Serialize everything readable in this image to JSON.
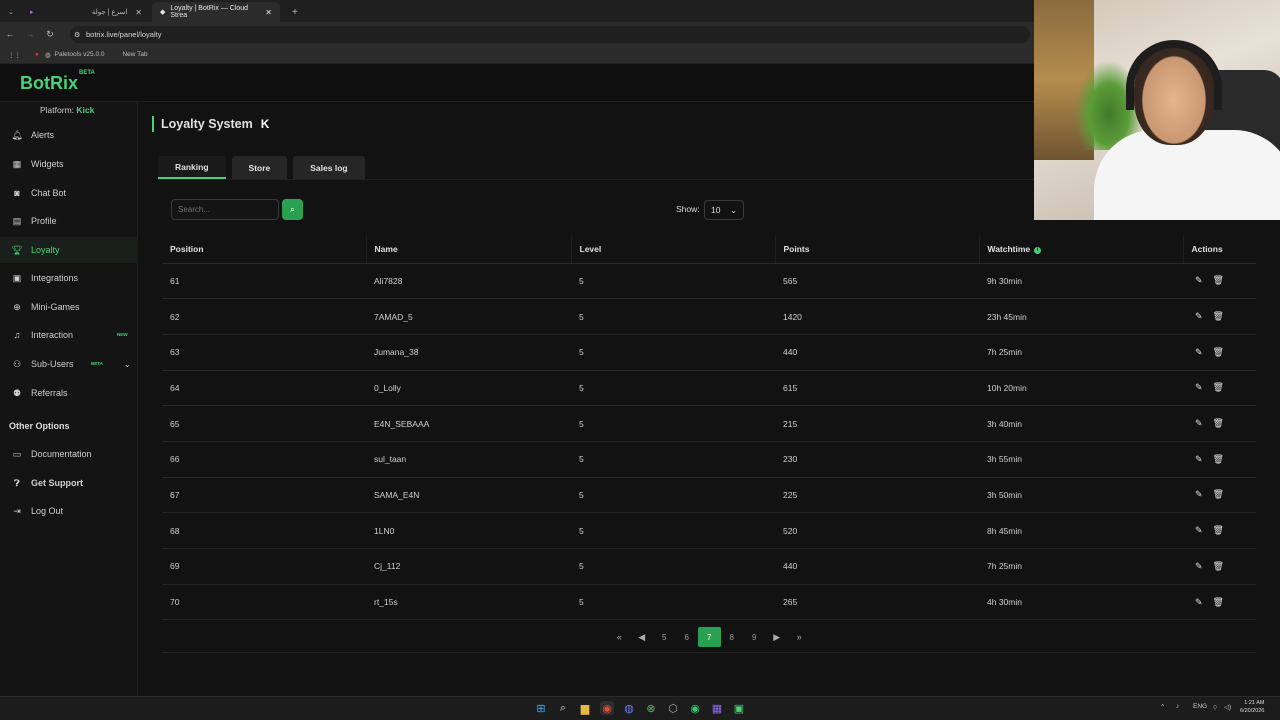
{
  "browser": {
    "tabs": [
      {
        "title": "اسرع | جولة",
        "active": false
      },
      {
        "title": "Loyalty | BotRix — Cloud Strea",
        "active": true
      }
    ],
    "url": "botrix.live/panel/loyalty",
    "bookmarks": [
      "Paletools v25.0.0",
      "New Tab"
    ]
  },
  "app": {
    "logo": "BotRix",
    "logo_badge": "BETA",
    "platform_label": "Platform:",
    "platform_value": "Kick"
  },
  "sidebar": {
    "items": [
      {
        "label": "Alerts",
        "icon": "bell-icon"
      },
      {
        "label": "Widgets",
        "icon": "grid-icon"
      },
      {
        "label": "Chat Bot",
        "icon": "robot-icon"
      },
      {
        "label": "Profile",
        "icon": "id-card-icon"
      },
      {
        "label": "Loyalty",
        "icon": "trophy-icon",
        "active": true
      },
      {
        "label": "Integrations",
        "icon": "plug-icon"
      },
      {
        "label": "Mini-Games",
        "icon": "gamepad-icon"
      },
      {
        "label": "Interaction",
        "icon": "music-icon",
        "badge": "NEW"
      },
      {
        "label": "Sub-Users",
        "icon": "users-icon",
        "badge": "BETA"
      },
      {
        "label": "Referrals",
        "icon": "user-group-icon"
      }
    ],
    "other_heading": "Other Options",
    "other_items": [
      {
        "label": "Documentation",
        "icon": "book-icon"
      },
      {
        "label": "Get Support",
        "icon": "question-icon"
      },
      {
        "label": "Log Out",
        "icon": "logout-icon"
      }
    ]
  },
  "main": {
    "title": "Loyalty System",
    "tabs": [
      "Ranking",
      "Store",
      "Sales log"
    ],
    "search_placeholder": "Search...",
    "show_label": "Show:",
    "show_value": "10",
    "columns": [
      "Position",
      "Name",
      "Level",
      "Points",
      "Watchtime",
      "Actions"
    ],
    "rows": [
      {
        "position": "61",
        "name": "Ali7828",
        "level": "5",
        "points": "565",
        "watchtime": "9h 30min"
      },
      {
        "position": "62",
        "name": "7AMAD_5",
        "level": "5",
        "points": "1420",
        "watchtime": "23h 45min"
      },
      {
        "position": "63",
        "name": "Jumana_38",
        "level": "5",
        "points": "440",
        "watchtime": "7h 25min"
      },
      {
        "position": "64",
        "name": "0_Lolly",
        "level": "5",
        "points": "615",
        "watchtime": "10h 20min"
      },
      {
        "position": "65",
        "name": "E4N_SEBAAA",
        "level": "5",
        "points": "215",
        "watchtime": "3h 40min"
      },
      {
        "position": "66",
        "name": "sul_taan",
        "level": "5",
        "points": "230",
        "watchtime": "3h 55min"
      },
      {
        "position": "67",
        "name": "SAMA_E4N",
        "level": "5",
        "points": "225",
        "watchtime": "3h 50min"
      },
      {
        "position": "68",
        "name": "1LN0",
        "level": "5",
        "points": "520",
        "watchtime": "8h 45min"
      },
      {
        "position": "69",
        "name": "Cj_112",
        "level": "5",
        "points": "440",
        "watchtime": "7h 25min"
      },
      {
        "position": "70",
        "name": "rt_15s",
        "level": "5",
        "points": "265",
        "watchtime": "4h 30min"
      }
    ],
    "pagination": {
      "pages": [
        "5",
        "6",
        "7",
        "8",
        "9"
      ],
      "current": "7"
    }
  },
  "taskbar": {
    "lang": "ENG",
    "time": "1:21 AM",
    "date": "6/20/2026"
  },
  "colors": {
    "accent": "#48d17a",
    "button": "#2aa152",
    "background": "#121212"
  }
}
